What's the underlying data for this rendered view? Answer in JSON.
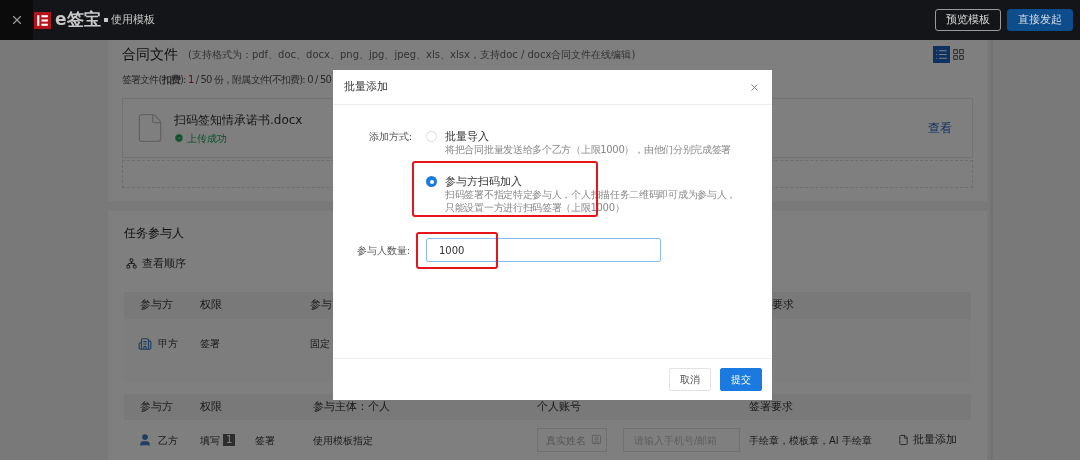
{
  "header": {
    "brand": "e签宝",
    "title": "使用模板",
    "buttons": [
      {
        "label": "预览模板",
        "kind": "outline"
      },
      {
        "label": "直接发起",
        "kind": "primary"
      }
    ]
  },
  "contract_files": {
    "title": "合同文件",
    "hint": "(支持格式为：pdf、doc、docx、png、jpg、jpeg、xls、xlsx，支持doc / docx合同文件在线编辑)",
    "counts": {
      "prefix": "签署文件(**扣费**): ",
      "used": "1",
      "suffix": " / 50 份，附属文件(不扣费): 0 / 50"
    },
    "view_modes": [
      {
        "kind": "list",
        "selected": true
      },
      {
        "kind": "grid",
        "selected": false
      }
    ],
    "files": [
      {
        "name": "扫码签知情承诺书.docx",
        "status": "上传成功",
        "action": "查看"
      }
    ]
  },
  "participants": {
    "title": "任务参与人",
    "order_link": "查看顺序",
    "tables": [
      {
        "columns": [
          "参与方",
          "权限",
          "参与",
          "要求"
        ],
        "rows": [
          {
            "party": "甲方",
            "kind": "org",
            "permissions": [
              {
                "label": "签署"
              }
            ],
            "subject": "固定"
          }
        ]
      },
      {
        "columns": [
          "参与方",
          "权限",
          "参与主体：个人",
          "个人账号",
          "签署要求"
        ],
        "rows": [
          {
            "party": "乙方",
            "kind": "person",
            "permissions": [
              {
                "label": "填写",
                "badge": "1"
              },
              {
                "label": "签署"
              }
            ],
            "subject": "使用模板指定",
            "name_placeholder": "真实姓名",
            "account_placeholder": "请输入手机号/邮箱",
            "requirement": "手绘章，模板章，AI 手绘章",
            "action": "批量添加"
          }
        ]
      }
    ]
  },
  "dialog": {
    "title": "批量添加",
    "method_label": "添加方式:",
    "options": [
      {
        "label": "批量导入",
        "description": [
          "将把合同批量发送给多个乙方（上限1000），由他们分别完成签署"
        ],
        "selected": false
      },
      {
        "label": "参与方扫码加入",
        "description": [
          "扫码签署不指定特定参与人，个人扫描任务二维码即可成为参与人，",
          "只能设置一方进行扫码签署（上限1000）"
        ],
        "selected": true
      }
    ],
    "count_label": "参与人数量:",
    "count_value": "1000",
    "buttons": [
      {
        "label": "取消",
        "kind": "default"
      },
      {
        "label": "提交",
        "kind": "primary"
      }
    ]
  }
}
